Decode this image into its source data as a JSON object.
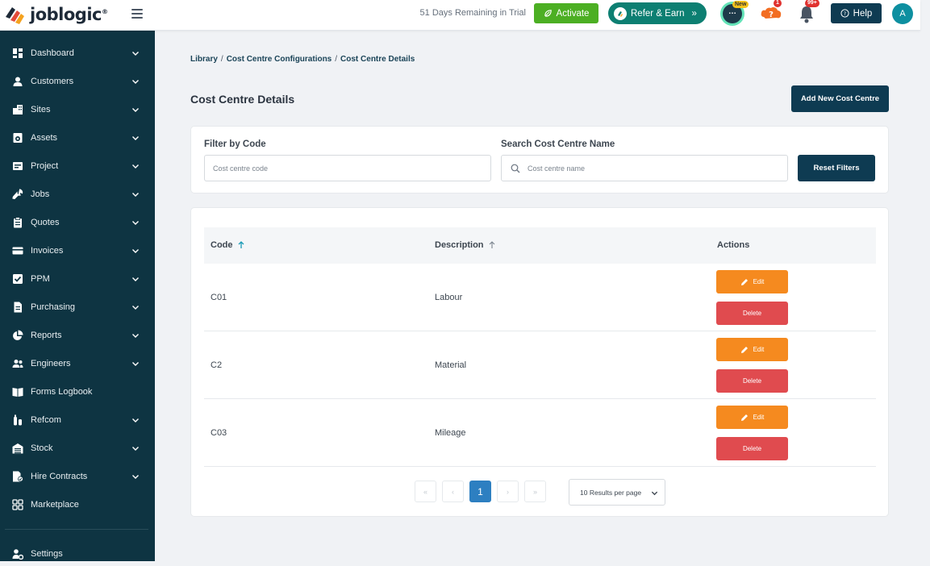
{
  "brand": {
    "name": "joblogic",
    "reg": "®"
  },
  "topbar": {
    "trial_text": "51 Days Remaining in Trial",
    "activate_label": "Activate",
    "refer_label": "Refer & Earn",
    "refer_arrow": "»",
    "chat_badge": "New",
    "help_badge": "1",
    "bell_badge": "99+",
    "help_label": "Help",
    "avatar_initial": "A"
  },
  "sidebar": {
    "items": [
      {
        "label": "Dashboard",
        "icon": "dashboard-icon"
      },
      {
        "label": "Customers",
        "icon": "user-icon"
      },
      {
        "label": "Sites",
        "icon": "building-icon"
      },
      {
        "label": "Assets",
        "icon": "asset-icon"
      },
      {
        "label": "Project",
        "icon": "project-icon"
      },
      {
        "label": "Jobs",
        "icon": "wrench-icon"
      },
      {
        "label": "Quotes",
        "icon": "clipboard-icon"
      },
      {
        "label": "Invoices",
        "icon": "card-icon"
      },
      {
        "label": "PPM",
        "icon": "checkbox-icon"
      },
      {
        "label": "Purchasing",
        "icon": "document-icon"
      },
      {
        "label": "Reports",
        "icon": "pie-chart-icon"
      },
      {
        "label": "Engineers",
        "icon": "users-icon"
      },
      {
        "label": "Forms Logbook",
        "icon": "book-icon"
      },
      {
        "label": "Refcom",
        "icon": "cylinder-icon"
      },
      {
        "label": "Stock",
        "icon": "warehouse-icon"
      },
      {
        "label": "Hire Contracts",
        "icon": "contract-icon"
      },
      {
        "label": "Marketplace",
        "icon": "grid-icon"
      },
      {
        "label": "Settings",
        "icon": "settings-icon"
      }
    ]
  },
  "breadcrumb": [
    "Library",
    "Cost Centre Configurations",
    "Cost Centre Details"
  ],
  "page": {
    "title": "Cost Centre Details",
    "add_button": "Add New Cost Centre"
  },
  "filters": {
    "code_label": "Filter by Code",
    "code_placeholder": "Cost centre code",
    "name_label": "Search Cost Centre Name",
    "name_placeholder": "Cost centre name",
    "reset_label": "Reset Filters"
  },
  "table": {
    "columns": [
      "Code",
      "Description",
      "Actions"
    ],
    "rows": [
      {
        "code": "C01",
        "description": "Labour"
      },
      {
        "code": "C2",
        "description": "Material"
      },
      {
        "code": "C03",
        "description": "Mileage"
      }
    ],
    "edit_label": "Edit",
    "delete_label": "Delete"
  },
  "pagination": {
    "first": "«",
    "prev": "‹",
    "current": "1",
    "next": "›",
    "last": "»",
    "per_page": "10 Results per page"
  },
  "colors": {
    "sidebar_bg": "#0e3442",
    "primary_dark": "#0e3b52",
    "activate_green": "#4caf23",
    "refer_teal": "#0d7f72",
    "edit_orange": "#f58a1f",
    "delete_red": "#e04b4f",
    "page_active": "#2d7fc1",
    "sort_active": "#1a9bb6"
  }
}
